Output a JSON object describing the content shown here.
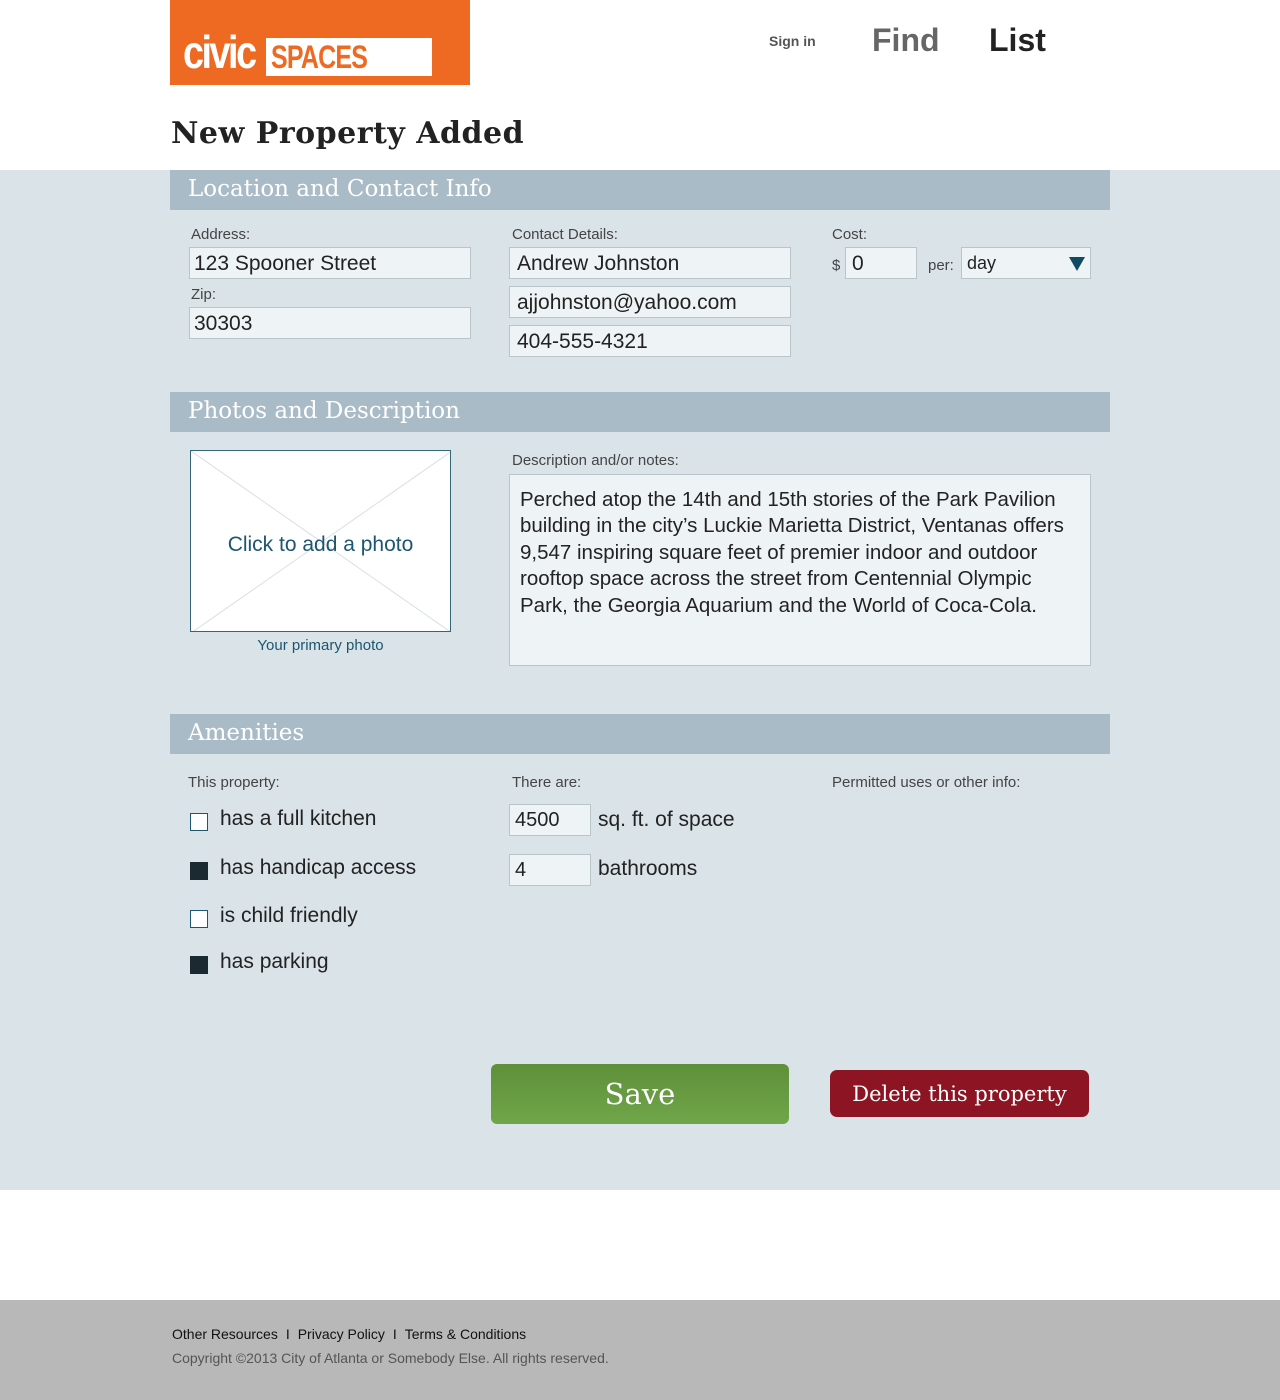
{
  "header": {
    "logo": {
      "part1": "civic",
      "part2": "SPACES"
    },
    "nav": {
      "sign_in": "Sign in",
      "find": "Find",
      "list": "List"
    }
  },
  "page_title": "New Property Added",
  "sections": {
    "location": {
      "title": "Location and Contact Info",
      "address_label": "Address:",
      "address": "123 Spooner Street",
      "zip_label": "Zip:",
      "zip": "30303",
      "contact_label": "Contact Details:",
      "contact_name": "Andrew Johnston",
      "contact_email": "ajjohnston@yahoo.com",
      "contact_phone": "404-555-4321",
      "cost_label": "Cost:",
      "currency": "$",
      "cost": "0",
      "per_label": "per:",
      "per_value": "day"
    },
    "photos": {
      "title": "Photos and Description",
      "photo_prompt": "Click to add a photo",
      "photo_caption": "Your primary photo",
      "description_label": "Description and/or notes:",
      "description": "Perched atop the 14th and 15th stories of the Park Pavilion building in the city’s Luckie Marietta District, Ventanas offers 9,547 inspiring square feet of premier indoor and outdoor rooftop space across the street from Centennial Olympic Park, the Georgia Aquarium and the World of Coca-Cola."
    },
    "amenities": {
      "title": "Amenities",
      "this_property_label": "This property:",
      "there_are_label": "There are:",
      "permitted_label": "Permitted uses or other info:",
      "checkboxes": [
        {
          "label": "has a full kitchen",
          "checked": false
        },
        {
          "label": "has handicap access",
          "checked": true
        },
        {
          "label": "is child friendly",
          "checked": false
        },
        {
          "label": "has parking",
          "checked": true
        }
      ],
      "sqft": "4500",
      "sqft_label": "sq. ft. of space",
      "bathrooms": "4",
      "bathrooms_label": "bathrooms"
    }
  },
  "actions": {
    "save": "Save",
    "delete": "Delete this property"
  },
  "footer": {
    "links": [
      "Other Resources",
      "Privacy Policy",
      "Terms & Conditions"
    ],
    "separator": "I",
    "copyright": "Copyright ©2013 City of Atlanta or Somebody Else. All rights reserved."
  },
  "colors": {
    "brand_orange": "#ee6a22",
    "section_bar": "#a9bbc6",
    "background_panel": "#d9e3e8",
    "save_green": "#6a9d45",
    "delete_red": "#8d1423",
    "link_blue": "#1c5670"
  }
}
